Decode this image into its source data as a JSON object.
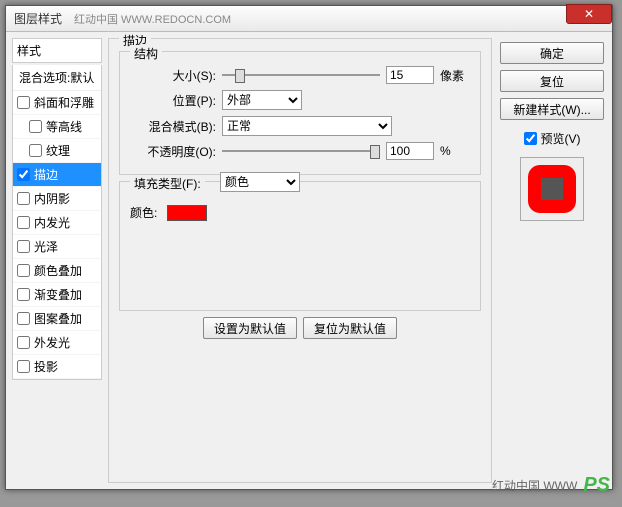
{
  "titlebar": {
    "title": "图层样式",
    "watermark": "红动中国  WWW.REDOCN.COM"
  },
  "left": {
    "header": "样式",
    "blend": "混合选项:默认",
    "items": [
      {
        "label": "斜面和浮雕",
        "indent": false,
        "checked": false,
        "selected": false
      },
      {
        "label": "等高线",
        "indent": true,
        "checked": false,
        "selected": false
      },
      {
        "label": "纹理",
        "indent": true,
        "checked": false,
        "selected": false
      },
      {
        "label": "描边",
        "indent": false,
        "checked": true,
        "selected": true
      },
      {
        "label": "内阴影",
        "indent": false,
        "checked": false,
        "selected": false
      },
      {
        "label": "内发光",
        "indent": false,
        "checked": false,
        "selected": false
      },
      {
        "label": "光泽",
        "indent": false,
        "checked": false,
        "selected": false
      },
      {
        "label": "颜色叠加",
        "indent": false,
        "checked": false,
        "selected": false
      },
      {
        "label": "渐变叠加",
        "indent": false,
        "checked": false,
        "selected": false
      },
      {
        "label": "图案叠加",
        "indent": false,
        "checked": false,
        "selected": false
      },
      {
        "label": "外发光",
        "indent": false,
        "checked": false,
        "selected": false
      },
      {
        "label": "投影",
        "indent": false,
        "checked": false,
        "selected": false
      }
    ]
  },
  "mid": {
    "title": "描边",
    "structure": {
      "title": "结构",
      "sizeLabel": "大小(S):",
      "sizeValue": "15",
      "sizeUnit": "像素",
      "positionLabel": "位置(P):",
      "positionValue": "外部",
      "blendLabel": "混合模式(B):",
      "blendValue": "正常",
      "opacityLabel": "不透明度(O):",
      "opacityValue": "100",
      "opacityUnit": "%"
    },
    "fill": {
      "title": "填充类型(F):",
      "typeLabel": "填充类型(F):",
      "typeValue": "颜色",
      "colorLabel": "颜色:",
      "colorValue": "#ff0000"
    },
    "defaults": {
      "set": "设置为默认值",
      "reset": "复位为默认值"
    }
  },
  "right": {
    "ok": "确定",
    "cancel": "复位",
    "newStyle": "新建样式(W)...",
    "previewLabel": "预览(V)",
    "previewChecked": true
  },
  "footer": {
    "wm": "红动中国  WWW",
    "logo": "PS"
  }
}
